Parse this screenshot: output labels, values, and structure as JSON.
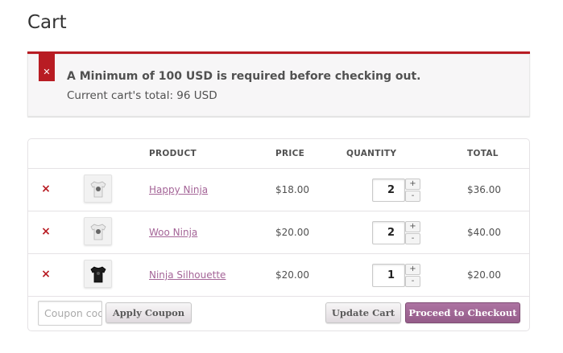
{
  "page": {
    "title": "Cart"
  },
  "notice": {
    "icon": "close-icon",
    "message": "A Minimum of 100 USD is required before checking out.",
    "detail": "Current cart's total: 96 USD",
    "accent_color": "#b81c23"
  },
  "cart": {
    "headers": {
      "product": "PRODUCT",
      "price": "PRICE",
      "quantity": "QUANTITY",
      "total": "TOTAL"
    },
    "items": [
      {
        "remove": "×",
        "name": "Happy Ninja",
        "price": "$18.00",
        "quantity": "2",
        "total": "$36.00",
        "thumb_icon": "tshirt-white-icon"
      },
      {
        "remove": "×",
        "name": "Woo Ninja",
        "price": "$20.00",
        "quantity": "2",
        "total": "$40.00",
        "thumb_icon": "tshirt-white-icon"
      },
      {
        "remove": "×",
        "name": "Ninja Silhouette",
        "price": "$20.00",
        "quantity": "1",
        "total": "$20.00",
        "thumb_icon": "tshirt-black-icon"
      }
    ],
    "qty_plus": "+",
    "qty_minus": "-"
  },
  "actions": {
    "coupon_placeholder": "Coupon code",
    "apply_coupon": "Apply Coupon",
    "update_cart": "Update Cart",
    "checkout": "Proceed to Checkout",
    "checkout_color": "#a46497"
  }
}
